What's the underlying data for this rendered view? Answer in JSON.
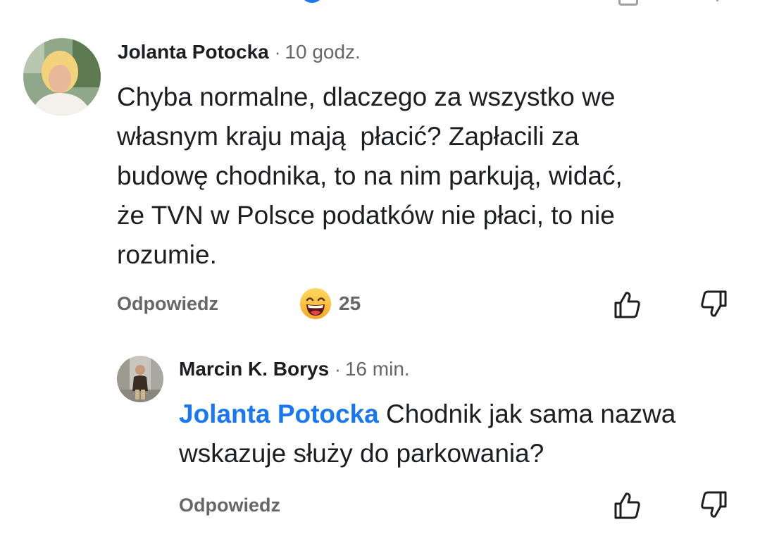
{
  "comments": [
    {
      "author": "Jolanta Potocka",
      "time": "10 godz.",
      "separator": "·",
      "text": "Chyba normalne, dlaczego za wszystko we\nwłasnym kraju mają  płacić? Zapłacili za\nbudowę chodnika, to na nim parkują, widać,\nże TVN w Polsce podatków nie płaci, to nie\nrozumie.",
      "reply_label": "Odpowiedz",
      "reaction": {
        "icon": "laughing-emoji-icon",
        "count": "25"
      },
      "like_icon": "thumbs-up-icon",
      "dislike_icon": "thumbs-down-icon"
    },
    {
      "author": "Marcin K. Borys",
      "time": "16 min.",
      "separator": "·",
      "mention": "Jolanta Potocka",
      "text": " Chodnik jak sama nazwa wskazuje służy do parkowania?",
      "reply_label": "Odpowiedz",
      "like_icon": "thumbs-up-icon",
      "dislike_icon": "thumbs-down-icon"
    }
  ],
  "colors": {
    "text": "#1c1e21",
    "secondary": "#65676b",
    "mention": "#1877f2"
  }
}
